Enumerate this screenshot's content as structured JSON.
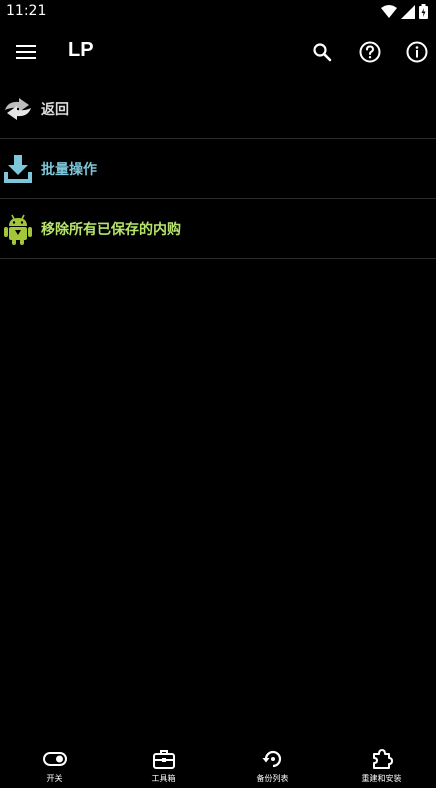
{
  "status_bar": {
    "time": "11:21",
    "icons": [
      "wifi-icon",
      "signal-icon",
      "battery-icon"
    ]
  },
  "app_bar": {
    "title": "LP",
    "actions": [
      "menu-icon",
      "search-icon",
      "help-icon",
      "info-icon"
    ]
  },
  "list": {
    "items": [
      {
        "label": "返回",
        "icon": "back-icon",
        "color": "#dcdcdc"
      },
      {
        "label": "批量操作",
        "icon": "download-icon",
        "color": "#7ec6d9"
      },
      {
        "label": "移除所有已保存的内购",
        "icon": "android-icon",
        "color": "#b6e36b"
      }
    ]
  },
  "bottom_nav": {
    "items": [
      {
        "label": "开关",
        "icon": "toggle-icon"
      },
      {
        "label": "工具箱",
        "icon": "toolbox-icon"
      },
      {
        "label": "备份列表",
        "icon": "backup-icon"
      },
      {
        "label": "重建和安装",
        "icon": "puzzle-icon"
      }
    ]
  }
}
